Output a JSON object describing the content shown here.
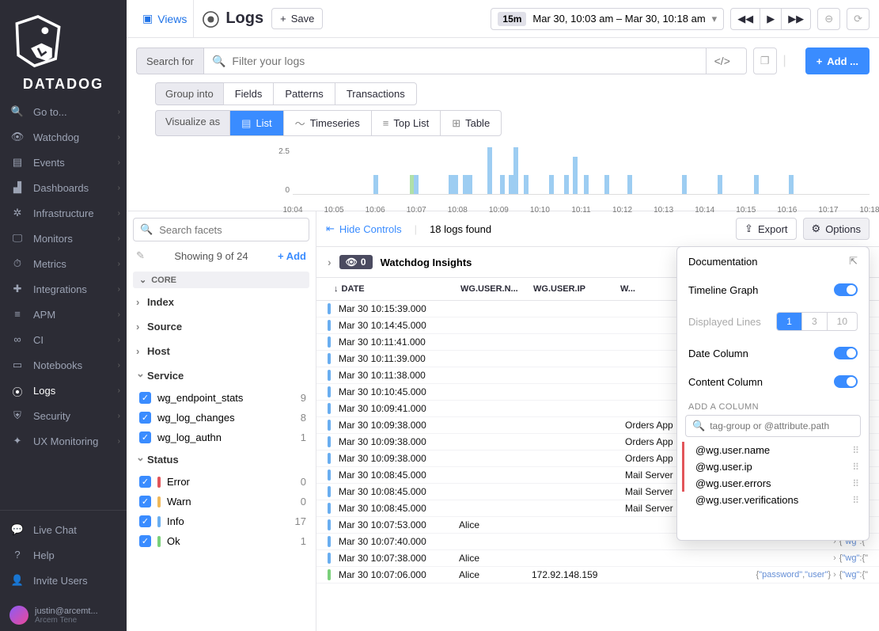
{
  "nav": {
    "brand": "DATADOG",
    "items": [
      {
        "label": "Go to...",
        "icon": "search"
      },
      {
        "label": "Watchdog",
        "icon": "binoculars"
      },
      {
        "label": "Events",
        "icon": "list"
      },
      {
        "label": "Dashboards",
        "icon": "chart"
      },
      {
        "label": "Infrastructure",
        "icon": "globe"
      },
      {
        "label": "Monitors",
        "icon": "monitor"
      },
      {
        "label": "Metrics",
        "icon": "speed"
      },
      {
        "label": "Integrations",
        "icon": "puzzle"
      },
      {
        "label": "APM",
        "icon": "apm"
      },
      {
        "label": "CI",
        "icon": "ci"
      },
      {
        "label": "Notebooks",
        "icon": "notebook"
      },
      {
        "label": "Logs",
        "icon": "logs",
        "active": true
      },
      {
        "label": "Security",
        "icon": "shield"
      },
      {
        "label": "UX Monitoring",
        "icon": "ux"
      }
    ],
    "bottom": [
      {
        "label": "Live Chat",
        "icon": "chat"
      },
      {
        "label": "Help",
        "icon": "help"
      },
      {
        "label": "Invite Users",
        "icon": "invite"
      }
    ],
    "user": {
      "email": "justin@arcemt...",
      "company": "Arcem Tene"
    }
  },
  "topbar": {
    "views": "Views",
    "title": "Logs",
    "save": "Save",
    "time_badge": "15m",
    "time_range": "Mar 30, 10:03 am – Mar 30, 10:18 am"
  },
  "search": {
    "label": "Search for",
    "placeholder": "Filter your logs",
    "add": "Add ...",
    "group_label": "Group into",
    "groups": [
      "Fields",
      "Patterns",
      "Transactions"
    ],
    "viz_label": "Visualize as",
    "viz": [
      "List",
      "Timeseries",
      "Top List",
      "Table"
    ]
  },
  "chart_data": {
    "type": "bar",
    "ylim": [
      0,
      2.5
    ],
    "y_ticks": [
      "2.5",
      "0"
    ],
    "x_ticks": [
      "10:04",
      "10:05",
      "10:06",
      "10:07",
      "10:08",
      "10:09",
      "10:10",
      "10:11",
      "10:12",
      "10:13",
      "10:14",
      "10:15",
      "10:16",
      "10:17",
      "10:18"
    ],
    "bars": [
      {
        "x_pct": 14.0,
        "h": 1.0,
        "status": "info"
      },
      {
        "x_pct": 20.3,
        "h": 1.0,
        "status": "ok"
      },
      {
        "x_pct": 21.0,
        "h": 1.0,
        "status": "info"
      },
      {
        "x_pct": 27.0,
        "h": 1.0,
        "status": "info"
      },
      {
        "x_pct": 27.8,
        "h": 1.0,
        "status": "info"
      },
      {
        "x_pct": 29.5,
        "h": 1.0,
        "status": "info"
      },
      {
        "x_pct": 30.3,
        "h": 1.0,
        "status": "info"
      },
      {
        "x_pct": 33.8,
        "h": 2.5,
        "status": "info"
      },
      {
        "x_pct": 36.0,
        "h": 1.0,
        "status": "info"
      },
      {
        "x_pct": 37.5,
        "h": 1.0,
        "status": "info"
      },
      {
        "x_pct": 38.3,
        "h": 2.5,
        "status": "info"
      },
      {
        "x_pct": 40.0,
        "h": 1.0,
        "status": "info"
      },
      {
        "x_pct": 44.4,
        "h": 1.0,
        "status": "info"
      },
      {
        "x_pct": 47.0,
        "h": 1.0,
        "status": "info"
      },
      {
        "x_pct": 48.5,
        "h": 2.0,
        "status": "info"
      },
      {
        "x_pct": 50.5,
        "h": 1.0,
        "status": "info"
      },
      {
        "x_pct": 54.0,
        "h": 1.0,
        "status": "info"
      },
      {
        "x_pct": 58.0,
        "h": 1.0,
        "status": "info"
      },
      {
        "x_pct": 67.5,
        "h": 1.0,
        "status": "info"
      },
      {
        "x_pct": 73.7,
        "h": 1.0,
        "status": "info"
      },
      {
        "x_pct": 80.0,
        "h": 1.0,
        "status": "info"
      },
      {
        "x_pct": 86.0,
        "h": 1.0,
        "status": "info"
      }
    ]
  },
  "facets": {
    "search_placeholder": "Search facets",
    "showing": "Showing 9 of 24",
    "add": "+   Add",
    "core_label": "CORE",
    "groups": [
      "Index",
      "Source",
      "Host"
    ],
    "service_label": "Service",
    "services": [
      {
        "name": "wg_endpoint_stats",
        "count": 9
      },
      {
        "name": "wg_log_changes",
        "count": 8
      },
      {
        "name": "wg_log_authn",
        "count": 1
      }
    ],
    "status_label": "Status",
    "statuses": [
      {
        "name": "Error",
        "color": "#e2555a",
        "count": 0
      },
      {
        "name": "Warn",
        "color": "#f0b95a",
        "count": 0
      },
      {
        "name": "Info",
        "color": "#6aaef0",
        "count": 17
      },
      {
        "name": "Ok",
        "color": "#7ad07a",
        "count": 1
      }
    ]
  },
  "results": {
    "hide_controls": "Hide Controls",
    "found": "18 logs found",
    "export": "Export",
    "options": "Options",
    "insights": "Watchdog Insights",
    "insights_count": "0",
    "headers": {
      "date": "DATE",
      "uname": "WG.USER.N...",
      "uip": "WG.USER.IP",
      "rest": "W..."
    },
    "rows": [
      {
        "date": "Mar 30 10:15:39.000",
        "uname": "",
        "uip": "",
        "content": "",
        "status": "info"
      },
      {
        "date": "Mar 30 10:14:45.000",
        "uname": "",
        "uip": "",
        "content": "",
        "status": "info"
      },
      {
        "date": "Mar 30 10:11:41.000",
        "uname": "",
        "uip": "",
        "content": "",
        "status": "info"
      },
      {
        "date": "Mar 30 10:11:39.000",
        "uname": "",
        "uip": "",
        "content": "",
        "status": "info"
      },
      {
        "date": "Mar 30 10:11:38.000",
        "uname": "",
        "uip": "",
        "content": "",
        "status": "info"
      },
      {
        "date": "Mar 30 10:10:45.000",
        "uname": "",
        "uip": "",
        "content": "",
        "status": "info"
      },
      {
        "date": "Mar 30 10:09:41.000",
        "uname": "",
        "uip": "",
        "content": "",
        "status": "info"
      },
      {
        "date": "Mar 30 10:09:38.000",
        "uname": "",
        "uip": "",
        "content": "Orders App",
        "status": "info"
      },
      {
        "date": "Mar 30 10:09:38.000",
        "uname": "",
        "uip": "",
        "content": "Orders App",
        "status": "info"
      },
      {
        "date": "Mar 30 10:09:38.000",
        "uname": "",
        "uip": "",
        "content": "Orders App",
        "status": "info"
      },
      {
        "date": "Mar 30 10:08:45.000",
        "uname": "",
        "uip": "",
        "content": "Mail Server",
        "status": "info"
      },
      {
        "date": "Mar 30 10:08:45.000",
        "uname": "",
        "uip": "",
        "content": "Mail Server",
        "status": "info"
      },
      {
        "date": "Mar 30 10:08:45.000",
        "uname": "",
        "uip": "",
        "content": "Mail Server",
        "status": "info"
      },
      {
        "date": "Mar 30 10:07:53.000",
        "uname": "Alice",
        "uip": "",
        "content": "",
        "status": "info",
        "json": true
      },
      {
        "date": "Mar 30 10:07:40.000",
        "uname": "",
        "uip": "",
        "content": "",
        "status": "info",
        "json": true
      },
      {
        "date": "Mar 30 10:07:38.000",
        "uname": "Alice",
        "uip": "",
        "content": "",
        "status": "info",
        "json": true
      },
      {
        "date": "Mar 30 10:07:06.000",
        "uname": "Alice",
        "uip": "172.92.148.159",
        "content": "",
        "status": "ok",
        "json_keys": [
          "password",
          "user"
        ]
      }
    ]
  },
  "options_panel": {
    "doc": "Documentation",
    "timeline": "Timeline Graph",
    "lines_label": "Displayed Lines",
    "lines": [
      "1",
      "3",
      "10"
    ],
    "date_col": "Date Column",
    "content_col": "Content Column",
    "add_label": "ADD A COLUMN",
    "add_placeholder": "tag-group or @attribute.path",
    "cols": [
      "@wg.user.name",
      "@wg.user.ip",
      "@wg.user.errors",
      "@wg.user.verifications"
    ]
  }
}
